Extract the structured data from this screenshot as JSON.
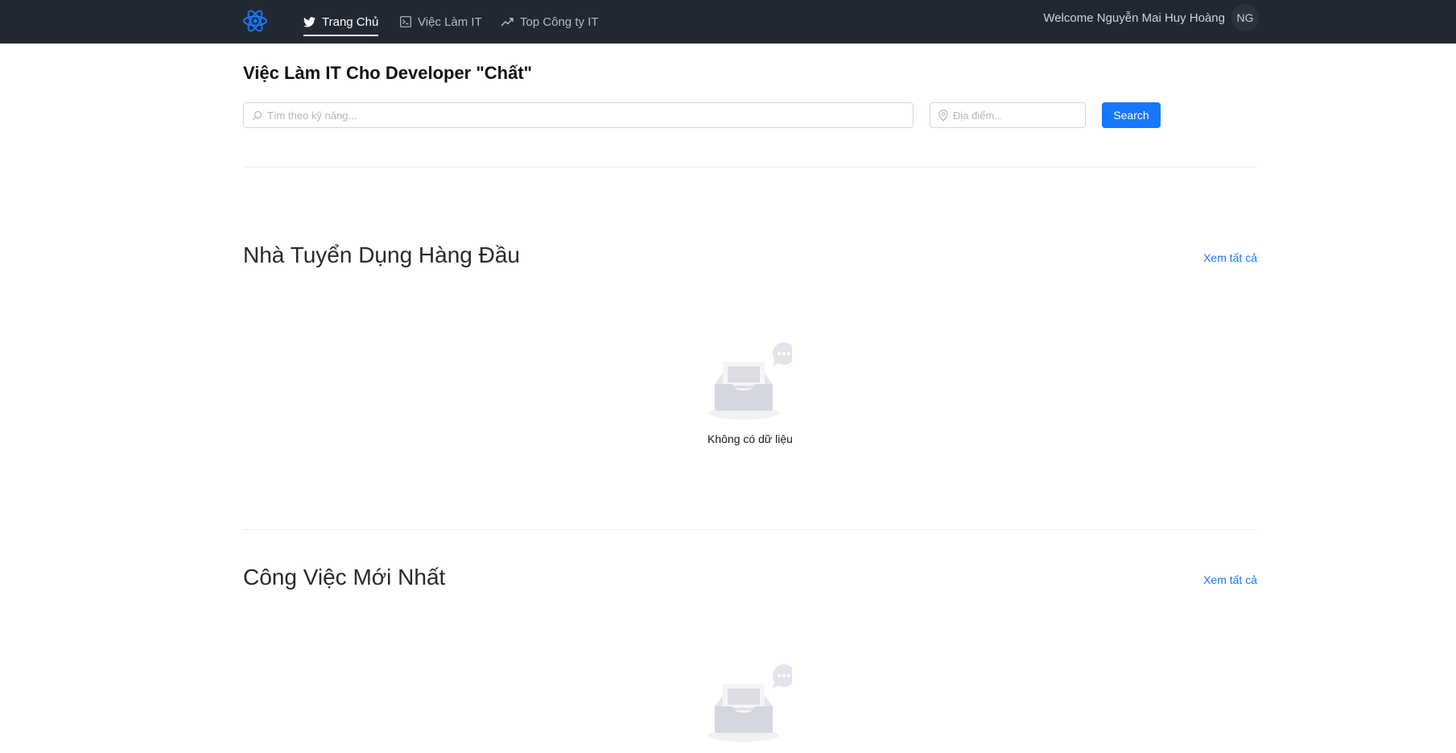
{
  "header": {
    "nav": [
      {
        "label": "Trang Chủ",
        "icon": "twitter-icon",
        "active": true
      },
      {
        "label": "Việc Làm IT",
        "icon": "terminal-icon",
        "active": false
      },
      {
        "label": "Top Công ty IT",
        "icon": "trending-up-icon",
        "active": false
      }
    ],
    "welcome": "Welcome Nguyễn Mai Huy Hoàng",
    "avatar_initials": "NG"
  },
  "hero": {
    "title": "Việc Làm IT Cho Developer \"Chất\"",
    "skill_placeholder": "Tìm theo kỹ năng...",
    "location_placeholder": "Địa điểm...",
    "search_label": "Search"
  },
  "sections": {
    "employers": {
      "title": "Nhà Tuyển Dụng Hàng Đầu",
      "see_all": "Xem tất cả",
      "empty_text": "Không có dữ liệu"
    },
    "jobs": {
      "title": "Công Việc Mới Nhất",
      "see_all": "Xem tất cả"
    }
  },
  "colors": {
    "header_bg": "#222831",
    "accent": "#1677ff",
    "logo": "#1677ff"
  }
}
